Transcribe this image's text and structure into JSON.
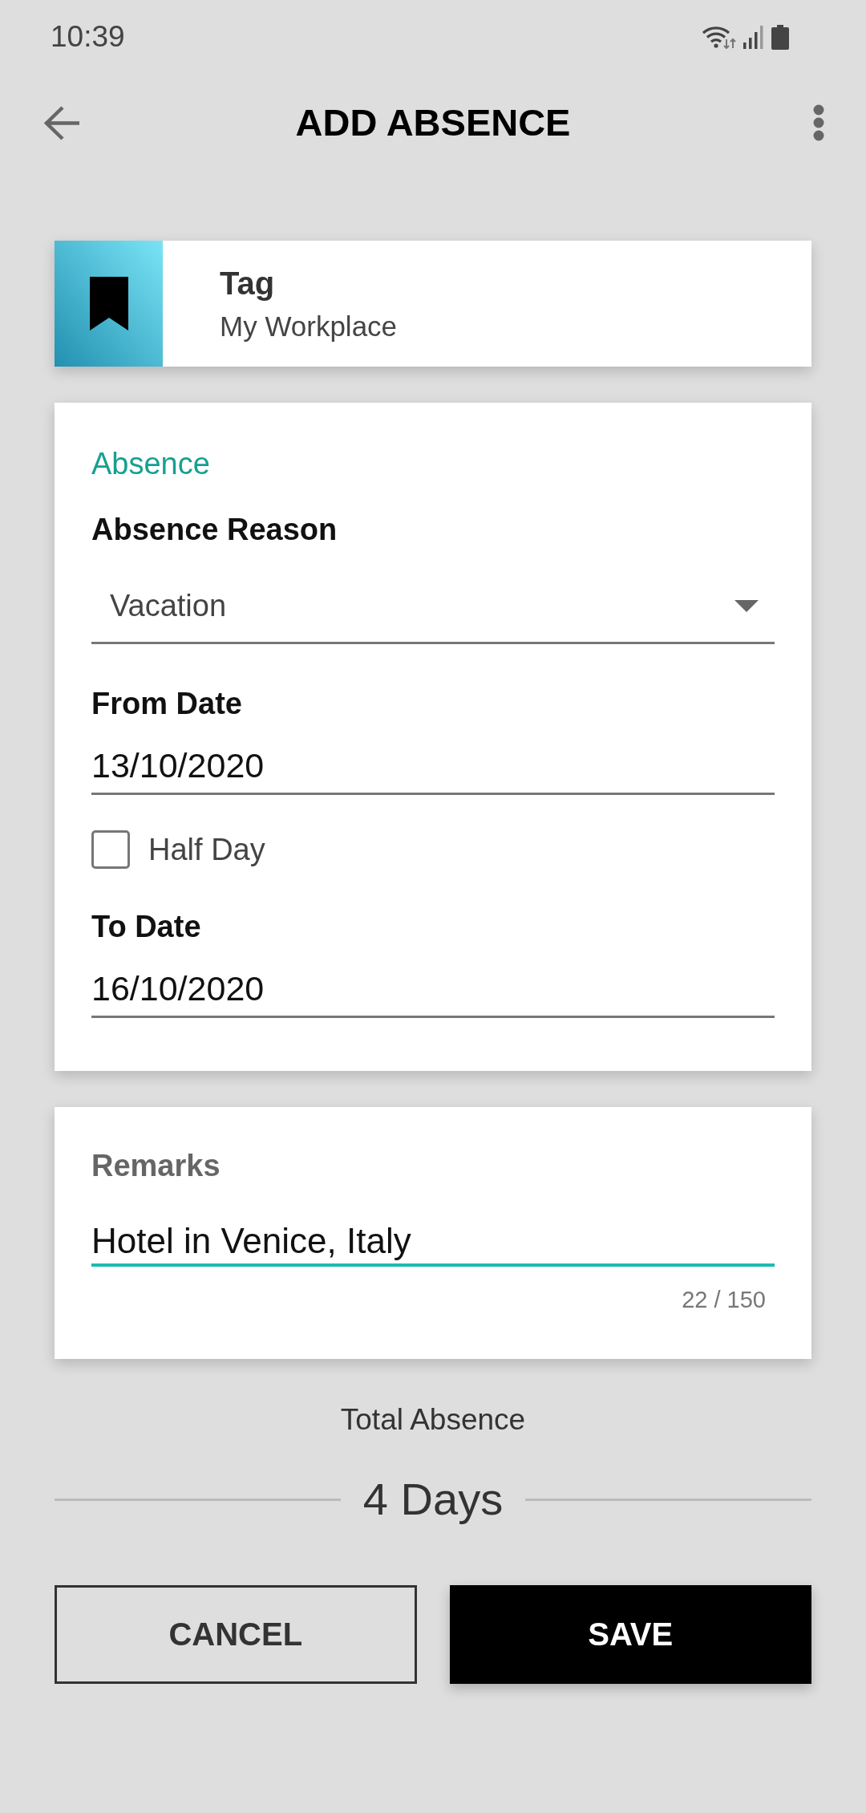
{
  "status_bar": {
    "time": "10:39"
  },
  "app_bar": {
    "title": "ADD ABSENCE"
  },
  "tag_card": {
    "title": "Tag",
    "subtitle": "My Workplace"
  },
  "absence_card": {
    "section_title": "Absence",
    "fields": [
      {
        "kind": "dropdown",
        "label": "Absence Reason",
        "value": "Vacation"
      },
      {
        "kind": "date",
        "label": "From Date",
        "value": "13/10/2020"
      },
      {
        "kind": "checkbox",
        "label": "Half Day",
        "checked": false
      },
      {
        "kind": "date",
        "label": "To Date",
        "value": "16/10/2020"
      }
    ]
  },
  "remarks_card": {
    "label": "Remarks",
    "value": "Hotel in Venice, Italy",
    "focused": true,
    "counter": "22 / 150"
  },
  "total": {
    "label": "Total Absence",
    "value": "4 Days"
  },
  "buttons": [
    {
      "kind": "outline",
      "label": "CANCEL"
    },
    {
      "kind": "filled",
      "label": "SAVE"
    }
  ]
}
